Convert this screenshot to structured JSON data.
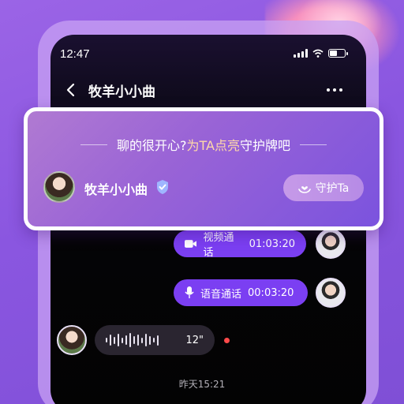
{
  "status_bar": {
    "time": "12:47"
  },
  "nav": {
    "title": "牧羊小小曲"
  },
  "guard_card": {
    "heading_prefix": "聊的很开心?",
    "heading_accent": "为TA点亮",
    "heading_suffix": "守护牌吧",
    "name": "牧羊小小曲",
    "button_label": "守护Ta"
  },
  "messages": {
    "video_call": {
      "label": "视频通话",
      "duration": "01:03:20"
    },
    "voice_call": {
      "label": "语音通话",
      "duration": "00:03:20"
    },
    "voice_message": {
      "duration": "12\""
    }
  },
  "timestamp": "昨天15:21",
  "colors": {
    "accent_purple": "#7b3ff2",
    "card_gradient_start": "#b07ad2",
    "card_gradient_end": "#7b53de",
    "unread_red": "#ff4a4a",
    "highlight_text": "#ffd9a8"
  }
}
